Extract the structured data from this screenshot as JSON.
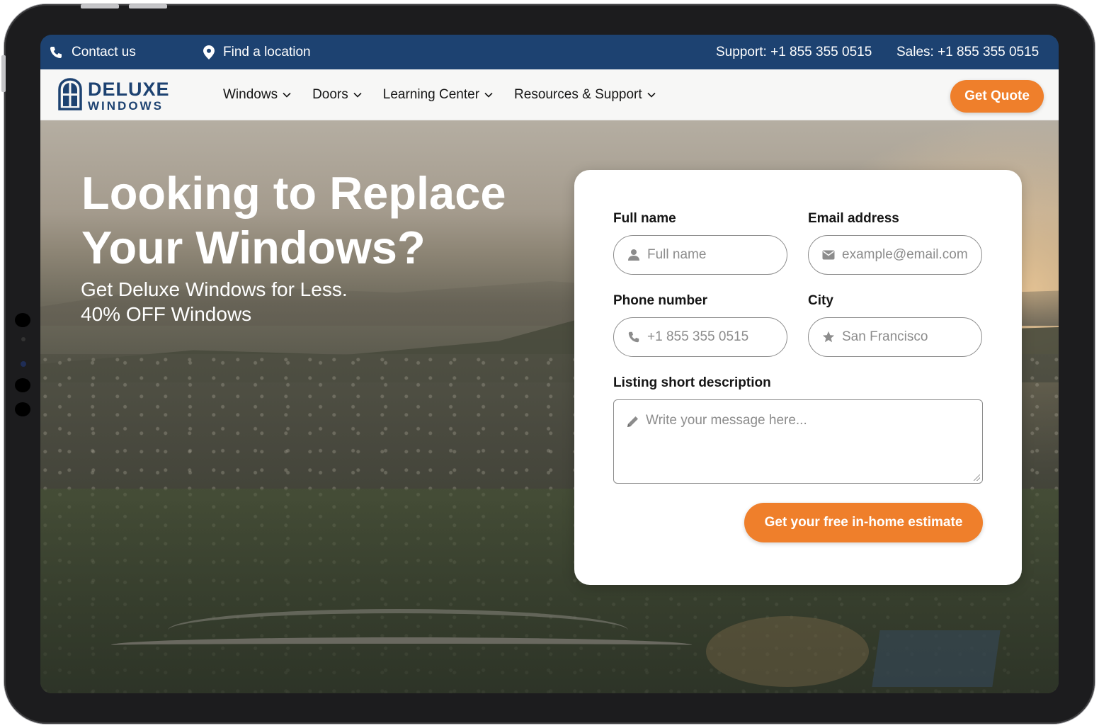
{
  "topbar": {
    "contact_label": "Contact us",
    "location_label": "Find a location",
    "support_label": "Support: +1 855 355 0515",
    "sales_label": "Sales: +1 855 355 0515"
  },
  "brand": {
    "logo_line1": "DELUXE",
    "logo_line2": "WINDOWS"
  },
  "nav": {
    "items": [
      {
        "label": "Windows"
      },
      {
        "label": "Doors"
      },
      {
        "label": "Learning Center"
      },
      {
        "label": "Resources & Support"
      }
    ],
    "cta_label": "Get Quote"
  },
  "hero": {
    "headline_line1": "Looking to Replace",
    "headline_line2": "Your Windows?",
    "subheadline": "Get Deluxe Windows for Less.",
    "offer": "40% OFF Windows"
  },
  "form": {
    "full_name": {
      "label": "Full name",
      "placeholder": "Full name"
    },
    "email": {
      "label": "Email address",
      "placeholder": "example@email.com"
    },
    "phone": {
      "label": "Phone number",
      "placeholder": "+1 855 355 0515"
    },
    "city": {
      "label": "City",
      "placeholder": "San Francisco"
    },
    "description": {
      "label": "Listing short description",
      "placeholder": "Write your message here..."
    },
    "submit_label": "Get your free in-home estimate"
  },
  "colors": {
    "topbar_bg": "#1d4271",
    "accent_orange": "#ef7f2b",
    "brand_navy": "#1d4271",
    "nav_bg": "#f7f7f6"
  },
  "icons": {
    "contact": "phone-icon",
    "location": "map-pin-icon",
    "nav_dropdown": "chevron-down-icon",
    "full_name": "user-icon",
    "email": "envelope-icon",
    "phone": "phone-icon",
    "city": "star-icon",
    "description": "pencil-icon"
  }
}
